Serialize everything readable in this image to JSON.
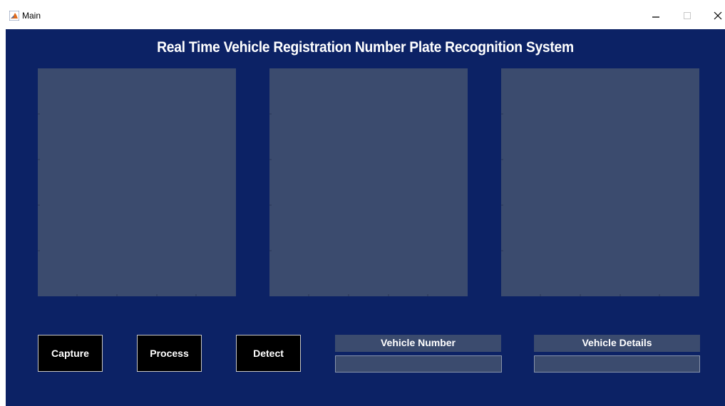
{
  "window": {
    "title": "Main",
    "icon": "matlab-icon",
    "controls": {
      "minimize": "–",
      "maximize": "☐",
      "close": "X"
    }
  },
  "figure": {
    "background": "#0c2265",
    "title": "Real Time Vehicle Registration Number Plate Recognition System",
    "axes": [
      {
        "name": "axes-1",
        "background": "#3b4b6e"
      },
      {
        "name": "axes-2",
        "background": "#3b4b6e"
      },
      {
        "name": "axes-3",
        "background": "#3b4b6e"
      }
    ],
    "buttons": {
      "capture": "Capture",
      "process": "Process",
      "detect": "Detect"
    },
    "vehicle_number": {
      "label": "Vehicle Number",
      "value": ""
    },
    "vehicle_details": {
      "label": "Vehicle Details",
      "value": ""
    }
  }
}
